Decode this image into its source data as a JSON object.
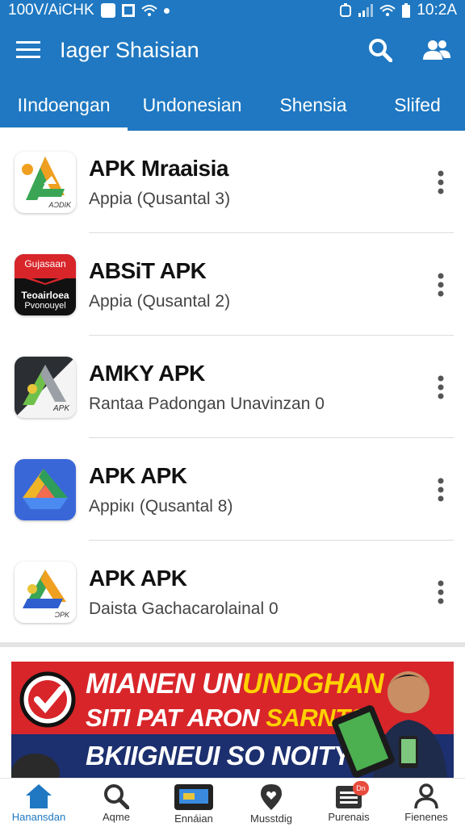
{
  "status_bar": {
    "left_text": "100V/AiCHK",
    "time": "10:2A"
  },
  "app_bar": {
    "title": "Iager Shaisian"
  },
  "tabs": [
    {
      "label": "IIndoengan",
      "active": true
    },
    {
      "label": "Undonesian",
      "active": false
    },
    {
      "label": "Shensia",
      "active": false
    },
    {
      "label": "Slifed",
      "active": false
    }
  ],
  "apps": [
    {
      "name": "APK Mraaisia",
      "subtitle": "Appia (Qusantal 3)",
      "icon_text": "AƆDIK"
    },
    {
      "name": "ABSiT APK",
      "subtitle": "Appia (Qusantal 2)",
      "icon_text_top": "Gujasaan",
      "icon_text_mid": "Teoairloea",
      "icon_text_bot": "Pvonouyel"
    },
    {
      "name": "AMKY APK",
      "subtitle": "Rantaa Padongan Unavinzan 0",
      "icon_text": "APK"
    },
    {
      "name": "APK APK",
      "subtitle": "Appiкı (Qusantal 8)"
    },
    {
      "name": "APK APK",
      "subtitle": "Daista Gachacarolainal 0",
      "icon_text": "ƆPK"
    }
  ],
  "banner": {
    "line1_white": "MIANEN UN",
    "line1_yellow": "UNDGHAN",
    "line2_white": "SITI PAT ARON ",
    "line2_yellow": "SARNTS",
    "line3": "BKIIGNEUI SO NOITY!"
  },
  "bottom_nav": [
    {
      "label": "Hanansdan",
      "icon": "home-icon",
      "active": true
    },
    {
      "label": "Aqme",
      "icon": "search-icon",
      "active": false
    },
    {
      "label": "Ennáian",
      "icon": "wallet-icon",
      "active": false
    },
    {
      "label": "Musstdig",
      "icon": "location-icon",
      "active": false
    },
    {
      "label": "Purenais",
      "icon": "list-icon",
      "active": false,
      "badge": "Dn"
    },
    {
      "label": "Fienenes",
      "icon": "profile-icon",
      "active": false
    }
  ],
  "colors": {
    "primary": "#1f78c1",
    "banner_red": "#d8252a",
    "banner_navy": "#1c2f6e",
    "highlight": "#ffd200"
  }
}
